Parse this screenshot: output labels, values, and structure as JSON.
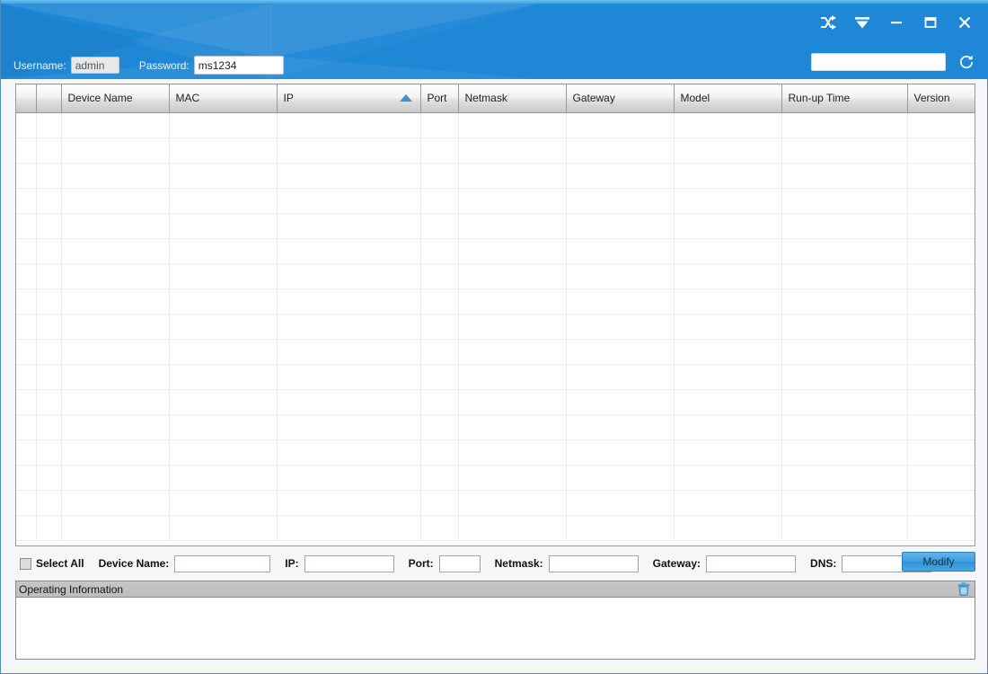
{
  "window": {
    "accent_color": "#1e87d6",
    "title": ""
  },
  "titlebar": {
    "controls": [
      {
        "name": "shuffle-icon",
        "label": "Shuffle"
      },
      {
        "name": "filter-icon",
        "label": "Filter"
      },
      {
        "name": "minimize-icon",
        "label": "Minimize"
      },
      {
        "name": "maximize-icon",
        "label": "Maximize"
      },
      {
        "name": "close-icon",
        "label": "Close"
      }
    ],
    "credentials": {
      "username_label": "Username:",
      "username_value": "admin",
      "password_label": "Password:",
      "password_value": "ms1234"
    },
    "search": {
      "value": "",
      "placeholder": "",
      "refresh_icon": "refresh-icon"
    }
  },
  "table": {
    "columns": [
      {
        "key": "check",
        "label": "",
        "width": 22
      },
      {
        "key": "index",
        "label": "",
        "width": 28
      },
      {
        "key": "device_name",
        "label": "Device Name",
        "width": 120
      },
      {
        "key": "mac",
        "label": "MAC",
        "width": 120
      },
      {
        "key": "ip",
        "label": "IP",
        "width": 160,
        "sorted": "asc"
      },
      {
        "key": "port",
        "label": "Port",
        "width": 42
      },
      {
        "key": "netmask",
        "label": "Netmask",
        "width": 120
      },
      {
        "key": "gateway",
        "label": "Gateway",
        "width": 120
      },
      {
        "key": "model",
        "label": "Model",
        "width": 120
      },
      {
        "key": "runup_time",
        "label": "Run-up Time",
        "width": 140
      },
      {
        "key": "version",
        "label": "Version",
        "width": 80
      },
      {
        "key": "extra",
        "label": "",
        "width": 38
      }
    ],
    "rows": [],
    "empty_row_count": 17,
    "sort_column": "IP",
    "sort_direction": "asc"
  },
  "edit_bar": {
    "select_all_label": "Select All",
    "select_all_checked": false,
    "fields": [
      {
        "name": "device-name",
        "label": "Device Name:",
        "value": "",
        "width_class": "w-dev"
      },
      {
        "name": "ip",
        "label": "IP:",
        "value": "",
        "width_class": "w-ip"
      },
      {
        "name": "port",
        "label": "Port:",
        "value": "",
        "width_class": "w-port"
      },
      {
        "name": "netmask",
        "label": "Netmask:",
        "value": "",
        "width_class": "w-mask"
      },
      {
        "name": "gateway",
        "label": "Gateway:",
        "value": "",
        "width_class": "w-gw"
      },
      {
        "name": "dns",
        "label": "DNS:",
        "value": "",
        "width_class": "w-dns"
      }
    ],
    "modify_label": "Modify"
  },
  "operating_information": {
    "title": "Operating Information",
    "clear_icon": "trash-icon",
    "log_text": ""
  }
}
